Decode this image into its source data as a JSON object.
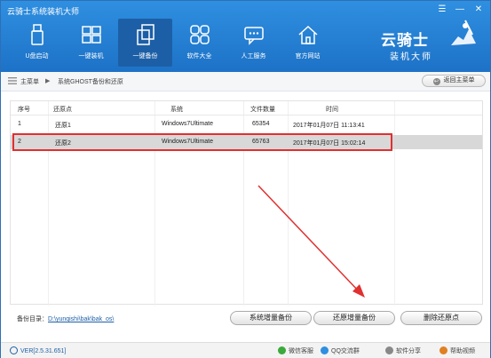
{
  "app": {
    "title": "云骑士系统装机大师"
  },
  "window_controls": {
    "menu": "☰",
    "min": "—",
    "close": "✕"
  },
  "nav": [
    {
      "label": "U盘启动",
      "icon": "usb-drive-icon"
    },
    {
      "label": "一键装机",
      "icon": "windows-icon"
    },
    {
      "label": "一键备份",
      "icon": "copy-icon"
    },
    {
      "label": "软件大全",
      "icon": "apps-icon"
    },
    {
      "label": "人工服务",
      "icon": "chat-icon"
    },
    {
      "label": "官方网站",
      "icon": "home-icon"
    }
  ],
  "logo": {
    "title": "云骑士",
    "subtitle": "装机大师"
  },
  "breadcrumb": {
    "home": "主菜单",
    "separator": "▶",
    "current": "系统GHOST备份和还原"
  },
  "back_button": {
    "label": "返回主菜单",
    "arrow": "↩"
  },
  "table": {
    "headers": {
      "seq": "序号",
      "restore_point": "还原点",
      "system": "系统",
      "file_count": "文件数量",
      "time": "时间"
    },
    "rows": [
      {
        "seq": "1",
        "restore_point": "还原1",
        "system": "Windows7Ultimate",
        "file_count": "65354",
        "time": "2017年01月07日 11:13:41",
        "selected": false
      },
      {
        "seq": "2",
        "restore_point": "还原2",
        "system": "Windows7Ultimate",
        "file_count": "65763",
        "time": "2017年01月07日 15:02:14",
        "selected": true
      }
    ]
  },
  "backup": {
    "label": "备份目录：",
    "path": "D:\\yunqishi\\bak\\bak_os\\"
  },
  "buttons": {
    "incremental_backup": "系统增量备份",
    "restore_incremental": "还原增量备份",
    "delete_restore_point": "删除还原点"
  },
  "status": {
    "version": "VER[2.5.31.651]",
    "wechat": "微信客服",
    "qq": "QQ交流群",
    "share": "软件分享",
    "help": "帮助视频"
  },
  "colors": {
    "accent": "#1d6fc4",
    "highlight": "#e03030",
    "selected_row": "#d8d8d8"
  }
}
